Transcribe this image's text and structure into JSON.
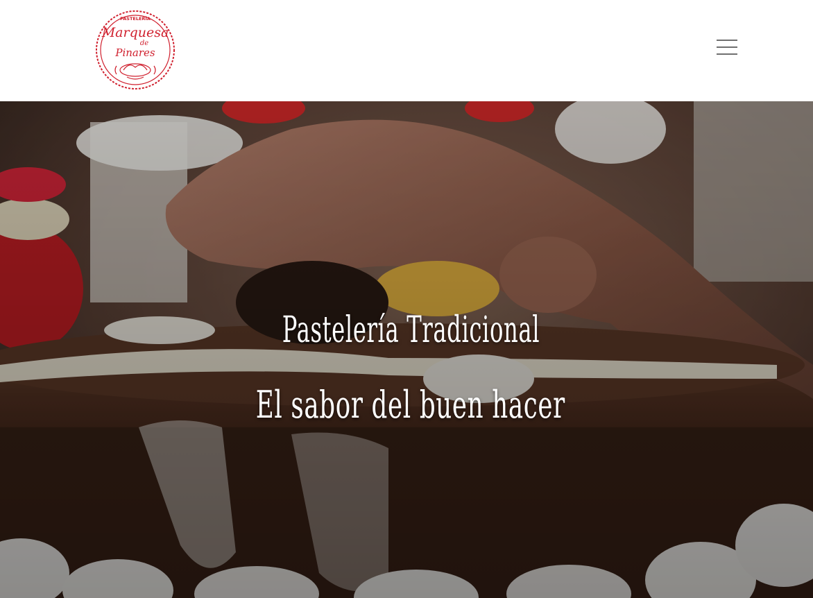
{
  "brand": {
    "logo_top": "PASTELERÍA",
    "logo_line1": "Marquesa",
    "logo_line2": "de",
    "logo_line3": "Pinares",
    "color": "#d0202e"
  },
  "nav": {
    "menu_icon": "hamburger-menu-icon"
  },
  "hero": {
    "title": "Pastelería Tradicional",
    "subtitle": "El sabor del buen hacer",
    "text_color": "#ffffff"
  }
}
